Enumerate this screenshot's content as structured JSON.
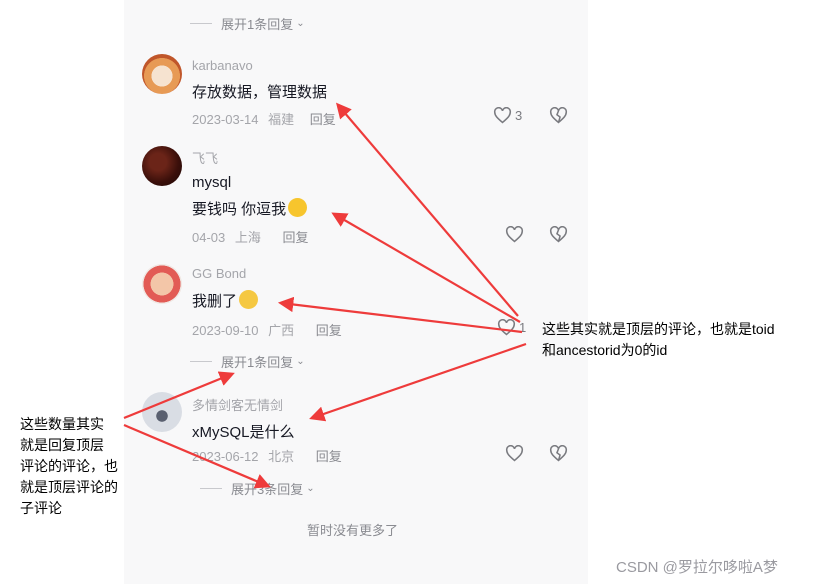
{
  "expand_top": "展开1条回复",
  "comments": [
    {
      "user": "karbanavo",
      "lines": [
        "存放数据，管理数据"
      ],
      "date": "2023-03-14",
      "location": "福建",
      "reply": "回复",
      "likes": "3"
    },
    {
      "user": "飞飞",
      "lines": [
        "mysql",
        "要钱吗 你逗我"
      ],
      "date": "04-03",
      "location": "上海",
      "reply": "回复",
      "likes": ""
    },
    {
      "user": "GG    Bond",
      "lines": [
        "我删了"
      ],
      "date": "2023-09-10",
      "location": "广西",
      "reply": "回复",
      "likes": "1"
    },
    {
      "user": "多情剑客无情剑",
      "lines": [
        "xMySQL是什么"
      ],
      "date": "2023-06-12",
      "location": "北京",
      "reply": "回复",
      "likes": ""
    }
  ],
  "expand_middle": "展开1条回复",
  "expand_bottom": "展开3条回复",
  "no_more": "暂时没有更多了",
  "annotations": {
    "right": [
      "这些其实就是顶层的评论，也就是toid",
      "和ancestorid为0的id"
    ],
    "left": [
      "这些数量其实",
      "就是回复顶层",
      "评论的评论，也",
      "就是顶层评论的",
      "子评论"
    ]
  },
  "watermark": "CSDN @罗拉尔哆啦A梦",
  "colors": {
    "arrow": "#ee3b3b",
    "panel": "#f8f8f9"
  }
}
